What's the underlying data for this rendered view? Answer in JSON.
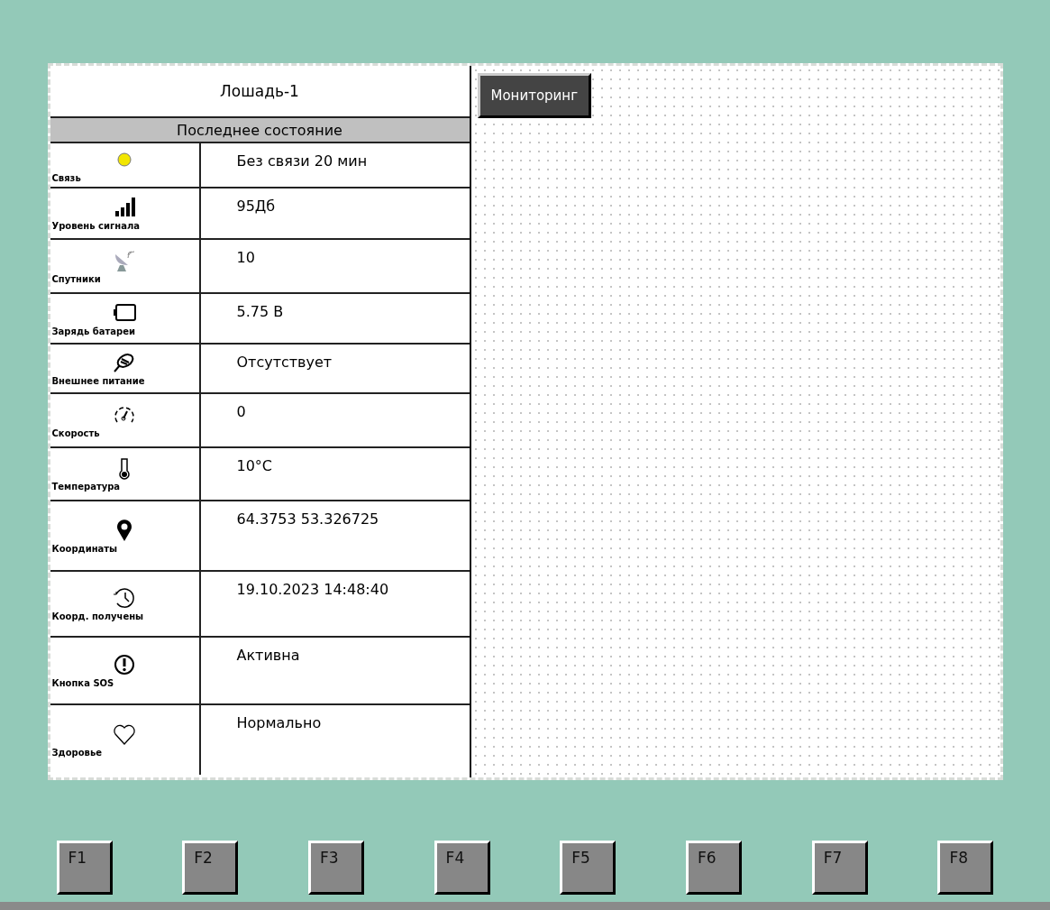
{
  "title": "Лошадь-1",
  "section_header": "Последнее состояние",
  "rows": [
    {
      "label": "Связь",
      "value": "Без связи 20 мин",
      "color": "#f2e600"
    },
    {
      "label": "Уровень сигнала",
      "value": "95Дб"
    },
    {
      "label": "Спутники",
      "value": "10"
    },
    {
      "label": "Зарядь батареи",
      "value": "5.75 В"
    },
    {
      "label": "Внешнее питание",
      "value": "Отсутствует"
    },
    {
      "label": "Скорость",
      "value": "0"
    },
    {
      "label": "Температура",
      "value": "10°C"
    },
    {
      "label": "Координаты",
      "value": "64.3753 53.326725"
    },
    {
      "label": "Коорд. получены",
      "value": "19.10.2023 14:48:40"
    },
    {
      "label": "Кнопка SOS",
      "value": "Активна"
    },
    {
      "label": "Здоровье",
      "value": "Нормально"
    }
  ],
  "monitoring_button": "Мониторинг",
  "function_keys": [
    "F1",
    "F2",
    "F3",
    "F4",
    "F5",
    "F6",
    "F7",
    "F8"
  ]
}
